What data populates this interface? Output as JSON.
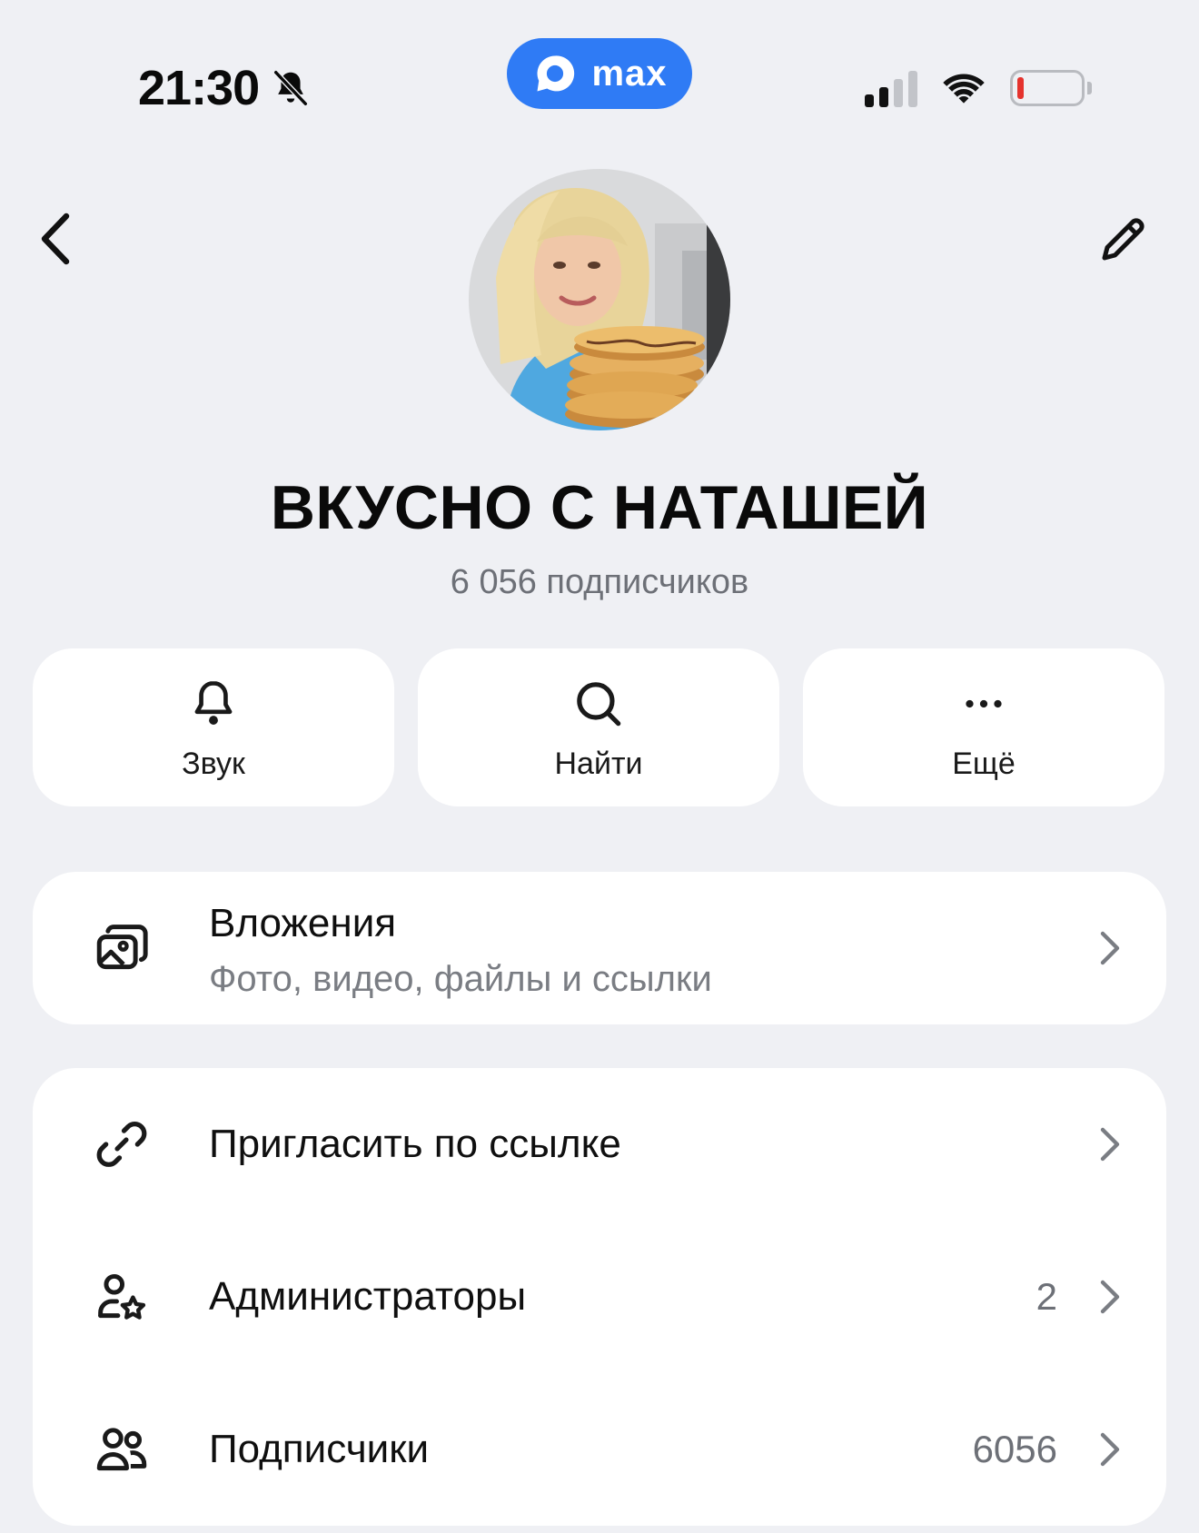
{
  "status_bar": {
    "time": "21:30",
    "app_badge": "max",
    "signal_bars_filled": 2,
    "signal_bars_total": 4,
    "battery_level": 0.1,
    "battery_color": "#e5332e"
  },
  "channel": {
    "name": "ВКУСНО С НАТАШЕЙ",
    "subscribers_label": "6 056 подписчиков"
  },
  "actions": [
    {
      "label": "Звук",
      "icon": "bell-icon"
    },
    {
      "label": "Найти",
      "icon": "search-icon"
    },
    {
      "label": "Ещё",
      "icon": "more-icon"
    }
  ],
  "attachments": {
    "title": "Вложения",
    "subtitle": "Фото, видео, файлы и ссылки",
    "icon": "gallery-icon"
  },
  "menu": [
    {
      "label": "Пригласить по ссылке",
      "count": "",
      "icon": "link-icon"
    },
    {
      "label": "Администраторы",
      "count": "2",
      "icon": "admin-icon"
    },
    {
      "label": "Подписчики",
      "count": "6056",
      "icon": "subscribers-icon"
    }
  ],
  "colors": {
    "accent": "#2f7bf5",
    "background": "#eff0f4",
    "card": "#ffffff",
    "secondary_text": "#6d7077"
  }
}
